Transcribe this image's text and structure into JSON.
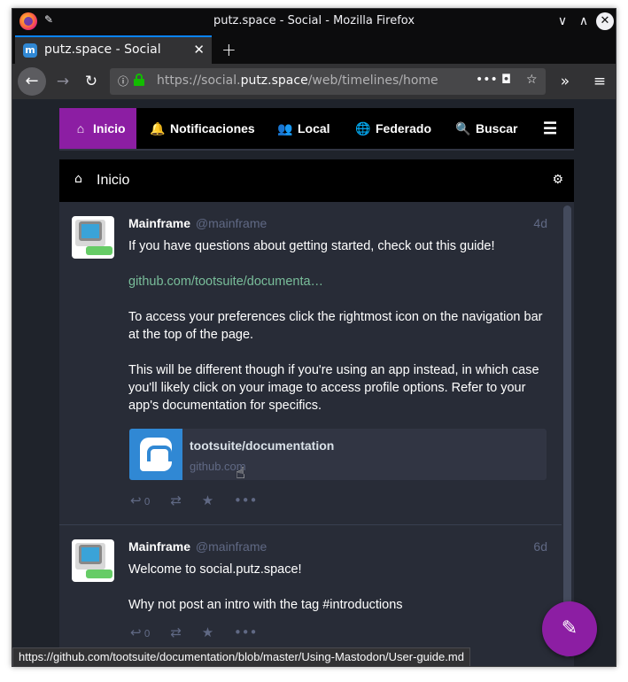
{
  "window": {
    "title": "putz.space - Social - Mozilla Firefox",
    "min_glyph": "∨",
    "max_glyph": "∧",
    "close_glyph": "✕"
  },
  "browser": {
    "tab_label": "putz.space - Social",
    "tab_favicon": "m",
    "tab_close": "✕",
    "new_tab": "+",
    "url_prefix": "https://social.",
    "url_host": "putz.space",
    "url_path": "/web/timelines/home",
    "status_link": "https://github.com/tootsuite/documentation/blob/master/Using-Mastodon/User-guide.md"
  },
  "nav": {
    "tabs": [
      {
        "label": "Inicio",
        "icon": "home-icon",
        "glyph": "⌂"
      },
      {
        "label": "Notificaciones",
        "icon": "bell-icon",
        "glyph": "🔔"
      },
      {
        "label": "Local",
        "icon": "users-icon",
        "glyph": "👥"
      },
      {
        "label": "Federado",
        "icon": "globe-icon",
        "glyph": "🌐"
      },
      {
        "label": "Buscar",
        "icon": "search-icon",
        "glyph": "🔍"
      }
    ],
    "menu_glyph": "☰"
  },
  "column": {
    "title": "Inicio",
    "home_glyph": "⌂",
    "settings_glyph": "⚙"
  },
  "statuses": [
    {
      "display_name": "Mainframe",
      "handle": "@mainframe",
      "time": "4d",
      "paragraphs": [
        "If you have questions about getting started, check out this guide!",
        "github.com/tootsuite/documenta…",
        "To access your preferences click the rightmost icon on the navigation bar at the top of the page.",
        "This will be different though if you're using an app instead, in which case you'll likely click on your image to access profile options. Refer to your app's documentation for specifics."
      ],
      "card": {
        "title": "tootsuite/documentation",
        "host": "github.com"
      },
      "reply_count": "0"
    },
    {
      "display_name": "Mainframe",
      "handle": "@mainframe",
      "time": "6d",
      "paragraphs": [
        "Welcome to social.putz.space!",
        "Why not post an intro with the tag #introductions"
      ],
      "reply_count": "0"
    }
  ],
  "colors": {
    "accent": "#8c1ea3",
    "link": "#79bd9a",
    "timeline_bg": "#282c37",
    "muted": "#606984"
  }
}
